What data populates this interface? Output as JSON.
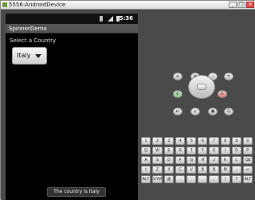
{
  "window": {
    "title": "5556:AndroidDevice"
  },
  "statusbar": {
    "time": "5:36"
  },
  "app": {
    "title": "SpinnerDemo",
    "prompt": "Select a Country",
    "spinner_value": "Italy",
    "toast": "The country is Italy"
  },
  "controls": {
    "home": "⌂",
    "menu": "≡",
    "vol_down": "–",
    "vol_up": "+",
    "call": "✆",
    "end": "✆",
    "back": "↩",
    "search": "⌕",
    "camera": "◉",
    "power": "⏻"
  },
  "keyboard": {
    "keys": [
      "1",
      "2",
      "3",
      "4",
      "5",
      "6",
      "7",
      "8",
      "9",
      "0",
      "Q",
      "W",
      "E",
      "R",
      "T",
      "Y",
      "U",
      "I",
      "O",
      "P",
      "A",
      "S",
      "D",
      "F",
      "G",
      "H",
      "J",
      "K",
      "L",
      "⌫",
      "⇧",
      "Z",
      "X",
      "C",
      "V",
      "B",
      "N",
      "M",
      ".",
      "↵",
      "ALT",
      "SYM",
      "@",
      "",
      "",
      "",
      ",",
      "/",
      "?",
      "ALT"
    ]
  }
}
